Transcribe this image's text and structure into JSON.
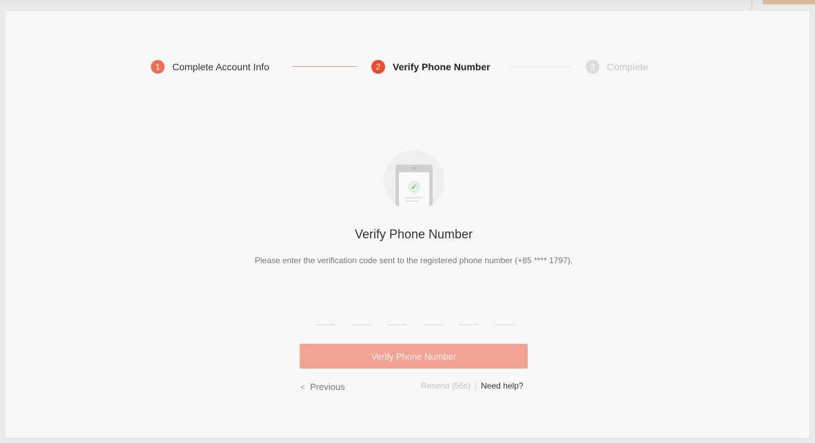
{
  "stepper": {
    "steps": [
      {
        "number": "1",
        "label": "Complete Account Info"
      },
      {
        "number": "2",
        "label": "Verify Phone Number"
      },
      {
        "number": "3",
        "label": "Complete"
      }
    ]
  },
  "illustration": {
    "icon": "phone-verified-icon"
  },
  "main": {
    "heading": "Verify Phone Number",
    "instruction": "Please enter the verification code sent to the registered phone number (+85 **** 1797).",
    "code_slots": [
      "",
      "",
      "",
      "",
      "",
      ""
    ]
  },
  "actions": {
    "verify_label": "Verify Phone Number",
    "previous_label": "Previous",
    "resend_label": "Resend (56s)",
    "separator": "|",
    "help_label": "Need help?"
  },
  "colors": {
    "accent": "#ee4d2d",
    "accent_light": "#f3a393",
    "check": "#3cab54"
  }
}
